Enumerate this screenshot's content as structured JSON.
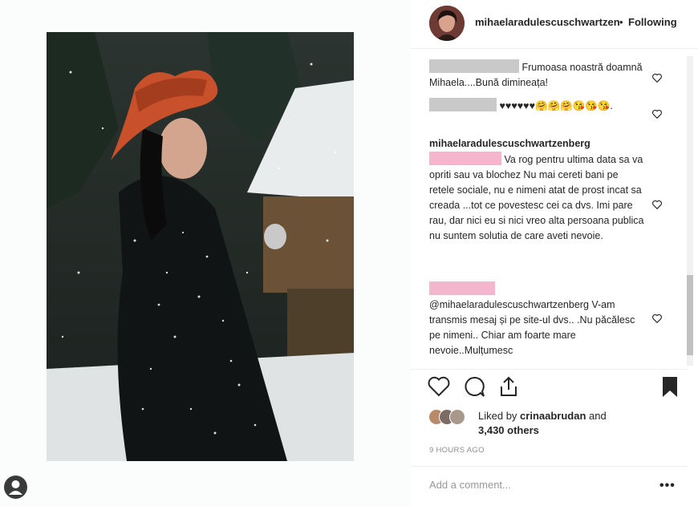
{
  "post": {
    "username": "mihaelaradulescuschwartzenberg",
    "follow_separator": "•",
    "follow_label": "Following"
  },
  "comments": [
    {
      "text": "Frumoasa noastră doamnă Mihaela....Bună dimineața!"
    },
    {
      "text": "♥♥♥♥♥♥🤗🤗🤗😘😘😘."
    },
    {
      "author": "mihaelaradulescuschwartzenberg",
      "text": "Va rog pentru ultima data sa va opriti sau va blochez Nu mai cereti bani pe retele sociale, nu e nimeni atat de prost incat sa creada ...tot ce povestesc cei ca dvs. Imi pare rau, dar nici eu si nici vreo alta persoana publica nu suntem solutia de care aveti nevoie."
    },
    {
      "text": "@mihaelaradulescuschwartzenberg V-am transmis mesaj și pe site-ul dvs.. .Nu păcălesc pe nimeni.. Chiar am foarte mare nevoie..Mulțumesc"
    }
  ],
  "likes": {
    "prefix": "Liked by",
    "user": "crinaabrudan",
    "and": "and",
    "others": "3,430 others"
  },
  "timestamp": "9 HOURS AGO",
  "add_comment_placeholder": "Add a comment...",
  "more_label": "•••",
  "icons": [
    "heart-icon",
    "comment-icon",
    "share-icon",
    "bookmark-icon",
    "user-icon"
  ],
  "colors": {
    "accent": "#262626",
    "muted": "#8e8e8e",
    "hat": "#c8502a"
  }
}
